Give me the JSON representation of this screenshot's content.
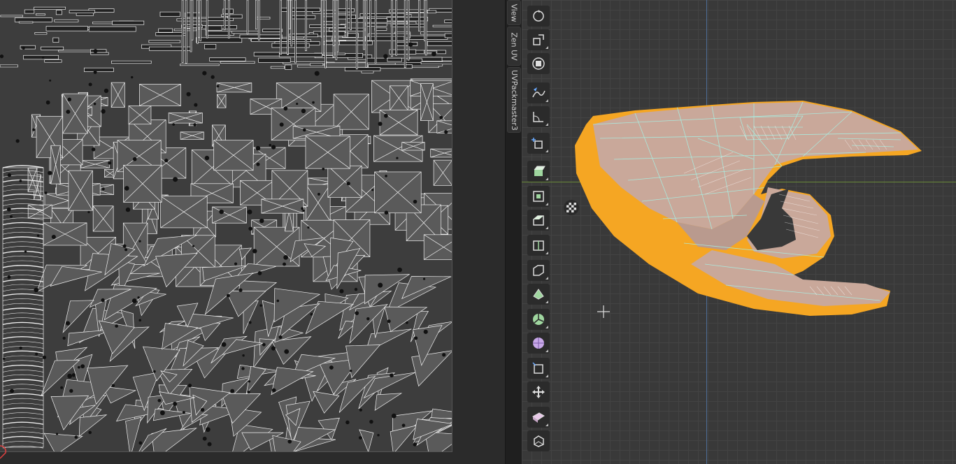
{
  "sidebar_tabs": [
    {
      "label": "View"
    },
    {
      "label": "Zen UV"
    },
    {
      "label": "UVPackmaster3"
    }
  ],
  "toolbar_tools": [
    {
      "name": "rotate-tool-icon"
    },
    {
      "name": "scale-tool-icon"
    },
    {
      "name": "transform-tool-icon"
    },
    {
      "name": "annotate-tool-icon"
    },
    {
      "name": "measure-tool-icon"
    },
    {
      "name": "add-cube-tool-icon"
    },
    {
      "name": "extrude-region-tool-icon"
    },
    {
      "name": "inset-faces-tool-icon"
    },
    {
      "name": "bevel-tool-icon"
    },
    {
      "name": "loop-cut-tool-icon"
    },
    {
      "name": "knife-tool-icon"
    },
    {
      "name": "poly-build-tool-icon"
    },
    {
      "name": "spin-tool-icon"
    },
    {
      "name": "smooth-tool-icon"
    },
    {
      "name": "edge-slide-tool-icon"
    },
    {
      "name": "shrink-fatten-tool-icon"
    },
    {
      "name": "shear-tool-icon"
    },
    {
      "name": "rip-region-tool-icon"
    }
  ],
  "colors": {
    "selection": "#f5a623",
    "wire": "#9ef0e0",
    "axis_x": "#6a8a3a",
    "axis_y": "#4d6d96"
  }
}
